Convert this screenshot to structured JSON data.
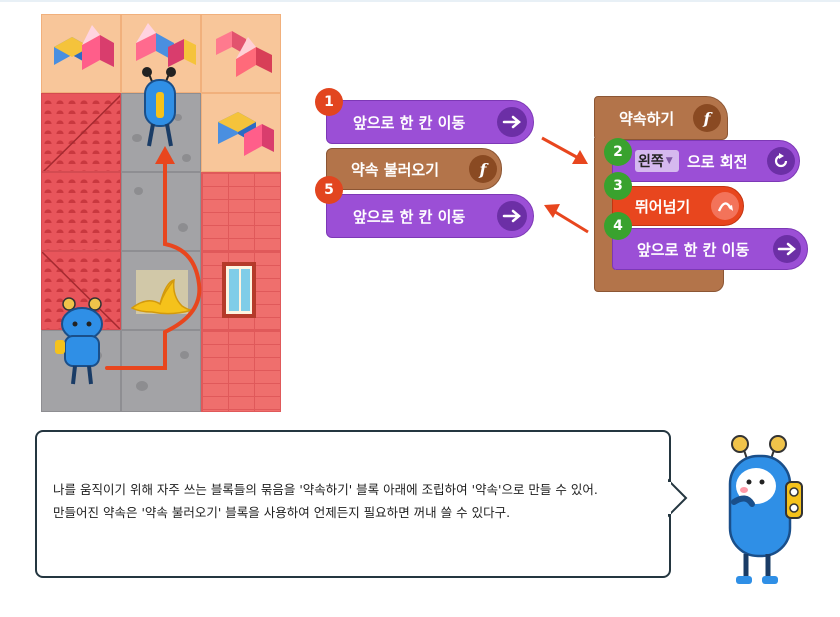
{
  "blocks": {
    "left_stack": {
      "move_forward_1": {
        "number": "1",
        "label": "앞으로 한 칸 이동",
        "icon": "arrow-right-icon"
      },
      "call_promise": {
        "label": "약속 불러오기",
        "icon": "function-icon"
      },
      "move_forward_2": {
        "number": "5",
        "label": "앞으로 한 칸 이동",
        "icon": "arrow-right-icon"
      }
    },
    "right_stack": {
      "define_promise": {
        "label": "약속하기",
        "icon": "function-icon"
      },
      "rotate": {
        "number": "2",
        "dropdown_value": "왼쪽",
        "label": "으로 회전",
        "icon": "rotate-icon"
      },
      "jump": {
        "number": "3",
        "label": "뛰어넘기",
        "icon": "jump-icon"
      },
      "move_forward": {
        "number": "4",
        "label": "앞으로 한 칸 이동",
        "icon": "arrow-right-icon"
      }
    }
  },
  "dialog": {
    "line1": "나를 움직이기 위해 자주 쓰는 블록들의 묶음을 '약속하기' 블록 아래에 조립하여 '약속'으로 만들 수 있어.",
    "line2": "만들어진 약속은 '약속 불러오기' 블록을 사용하여 언제든지 필요하면 꺼내 쓸 수 있다구."
  },
  "colors": {
    "block_purple": "#9b4fd6",
    "block_brown": "#b3744a",
    "badge_red": "#e2451f",
    "badge_green": "#39a22e",
    "path_arrow": "#e8461e",
    "dialog_border": "#243640"
  }
}
